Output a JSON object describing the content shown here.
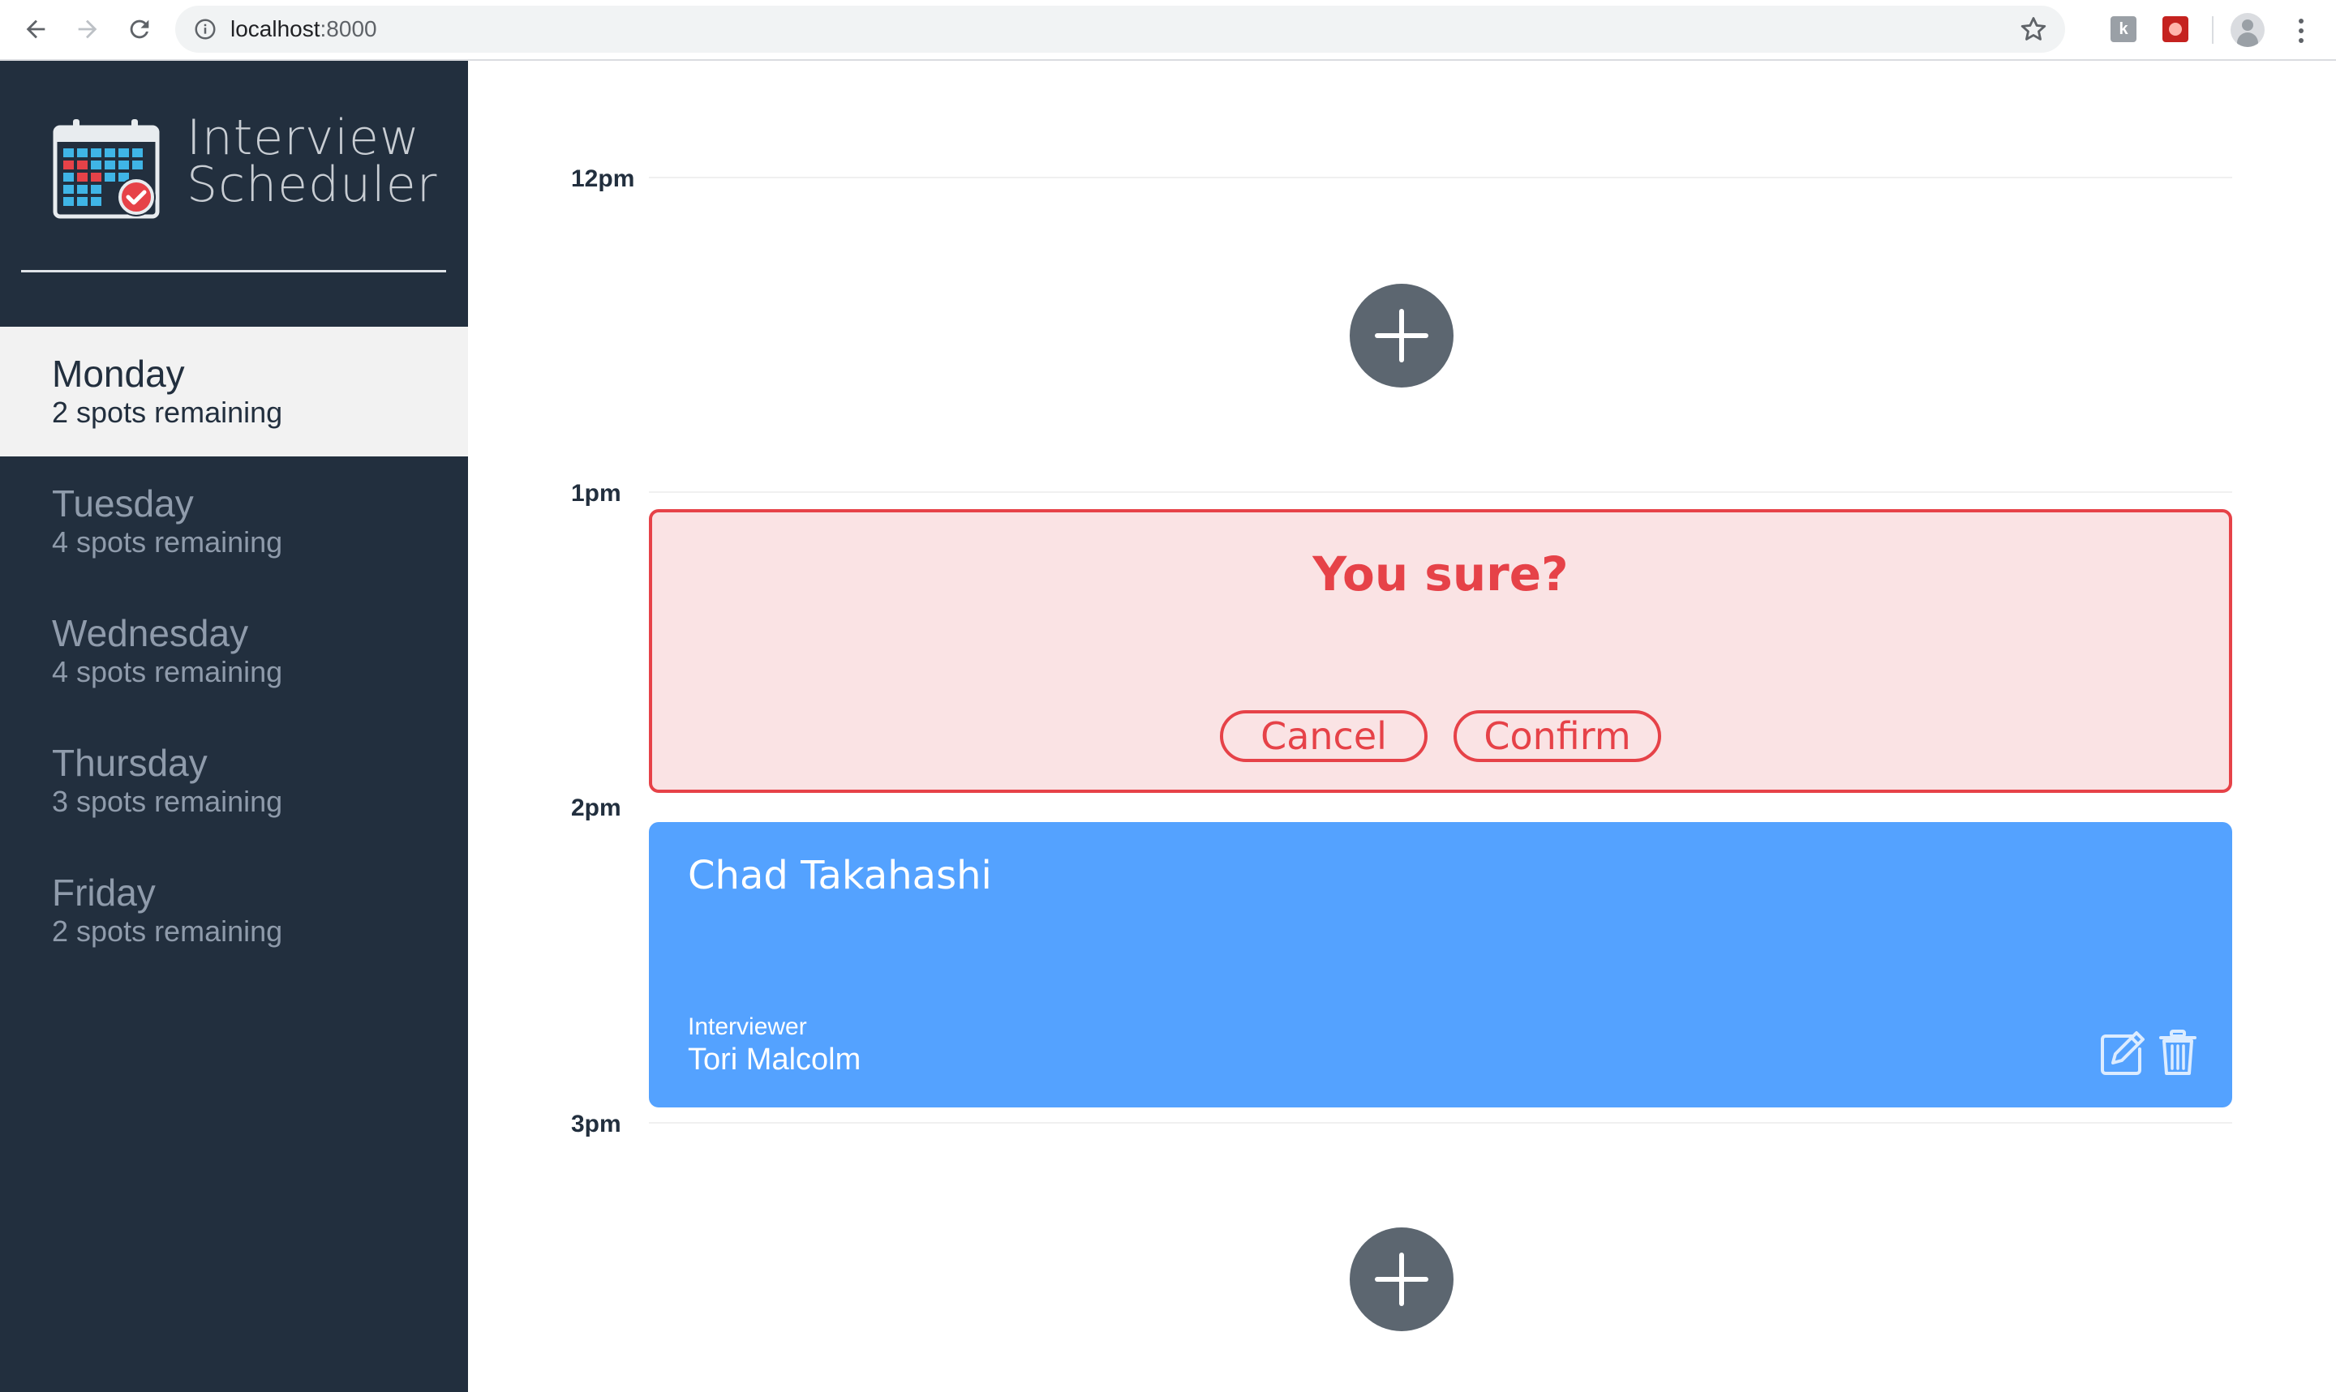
{
  "browser": {
    "url_host": "localhost",
    "url_port": ":8000",
    "extension_1_glyph": "k"
  },
  "sidebar": {
    "brand_line1": "Interview",
    "brand_line2": "Scheduler",
    "days": [
      {
        "name": "Monday",
        "spots": "2 spots remaining",
        "selected": true
      },
      {
        "name": "Tuesday",
        "spots": "4 spots remaining",
        "selected": false
      },
      {
        "name": "Wednesday",
        "spots": "4 spots remaining",
        "selected": false
      },
      {
        "name": "Thursday",
        "spots": "3 spots remaining",
        "selected": false
      },
      {
        "name": "Friday",
        "spots": "2 spots remaining",
        "selected": false
      }
    ]
  },
  "schedule": {
    "times": [
      "12pm",
      "1pm",
      "2pm",
      "3pm"
    ],
    "confirm": {
      "message": "You sure?",
      "cancel_label": "Cancel",
      "confirm_label": "Confirm"
    },
    "appointment": {
      "student": "Chad Takahashi",
      "interviewer_label": "Interviewer",
      "interviewer": "Tori Malcolm"
    }
  },
  "colors": {
    "sidebar_bg": "#222f3e",
    "danger": "#e64248",
    "danger_bg": "#fae3e4",
    "appointment_bg": "#54a2ff",
    "add_button": "#5c6670"
  },
  "icons": [
    "back-arrow-icon",
    "forward-arrow-icon",
    "reload-icon",
    "info-icon",
    "bookmark-star-icon",
    "calendar-logo-icon",
    "add-icon",
    "edit-icon",
    "trash-icon",
    "profile-avatar-icon",
    "kebab-menu-icon"
  ]
}
